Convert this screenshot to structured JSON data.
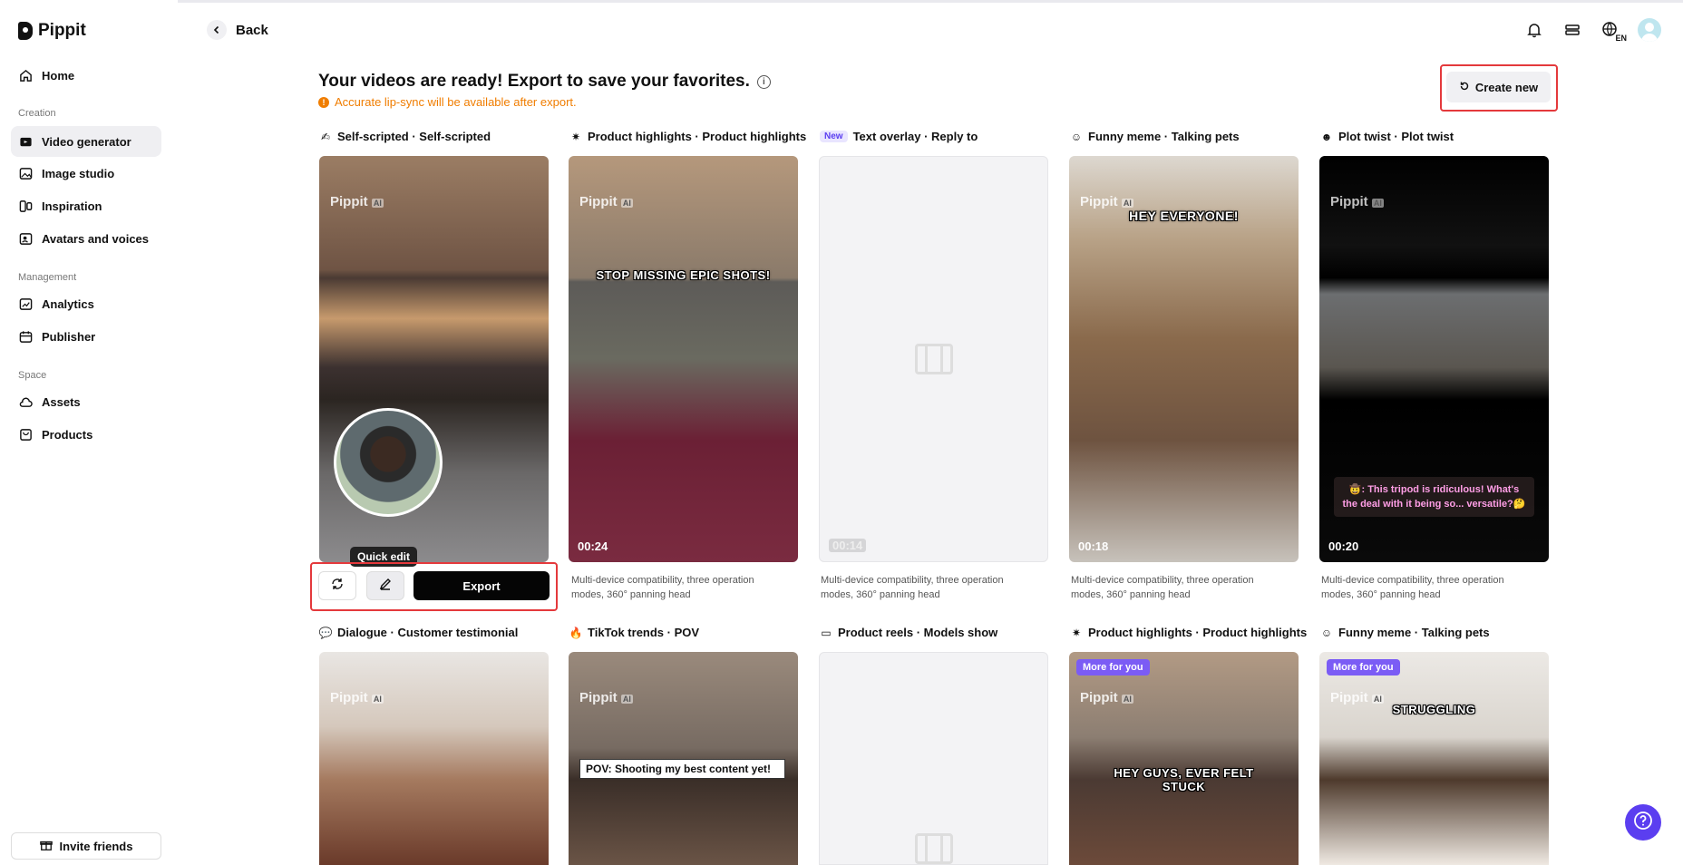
{
  "sidebar": {
    "brand": "Pippit",
    "items": [
      {
        "label": "Home"
      },
      {
        "label": "Video generator"
      },
      {
        "label": "Image studio"
      },
      {
        "label": "Inspiration"
      },
      {
        "label": "Avatars and voices"
      },
      {
        "label": "Analytics"
      },
      {
        "label": "Publisher"
      },
      {
        "label": "Assets"
      },
      {
        "label": "Products"
      }
    ],
    "sections": [
      "Creation",
      "Management",
      "Space"
    ],
    "invite_label": "Invite friends"
  },
  "topbar": {
    "back_label": "Back",
    "lang": "EN"
  },
  "header": {
    "title": "Your videos are ready! Export to save your favorites.",
    "warning": "Accurate lip-sync will be available after export.",
    "create_label": "Create new"
  },
  "cards": [
    {
      "label": "Self-scripted · Self-scripted",
      "desc": "",
      "duration": ""
    },
    {
      "label": "Product highlights · Product highlights",
      "desc": "Multi-device compatibility, three operation modes, 360° panning head",
      "duration": "00:24",
      "caption": "STOP MISSING EPIC SHOTS!"
    },
    {
      "label": "Text overlay · Reply to",
      "badge": "New",
      "desc": "Multi-device compatibility, three operation modes, 360° panning head",
      "duration": "00:14"
    },
    {
      "label": "Funny meme · Talking pets",
      "desc": "Multi-device compatibility, three operation modes, 360° panning head",
      "duration": "00:18",
      "caption": "HEY EVERYONE!"
    },
    {
      "label": "Plot twist · Plot twist",
      "desc": "Multi-device compatibility, three operation modes, 360° panning head",
      "duration": "00:20",
      "caption": "🤠: This tripod is ridiculous! What's the deal with it being so... versatile?🤔"
    },
    {
      "label": "Dialogue · Customer testimonial"
    },
    {
      "label": "TikTok trends · POV",
      "caption": "POV: Shooting my best content yet!"
    },
    {
      "label": "Product reels · Models show"
    },
    {
      "label": "Product highlights · Product highlights",
      "badge": "More for you",
      "caption": "HEY GUYS, EVER FELT STUCK"
    },
    {
      "label": "Funny meme · Talking pets",
      "badge": "More for you",
      "caption": "STRUGGLING"
    }
  ],
  "watermark": "Pippit",
  "watermark_tag": "AI",
  "action_bar": {
    "tooltip": "Quick edit",
    "export_label": "Export"
  },
  "colors": {
    "accent": "#5b3ef0",
    "warning": "#f07d00",
    "highlight": "#e4393c"
  }
}
